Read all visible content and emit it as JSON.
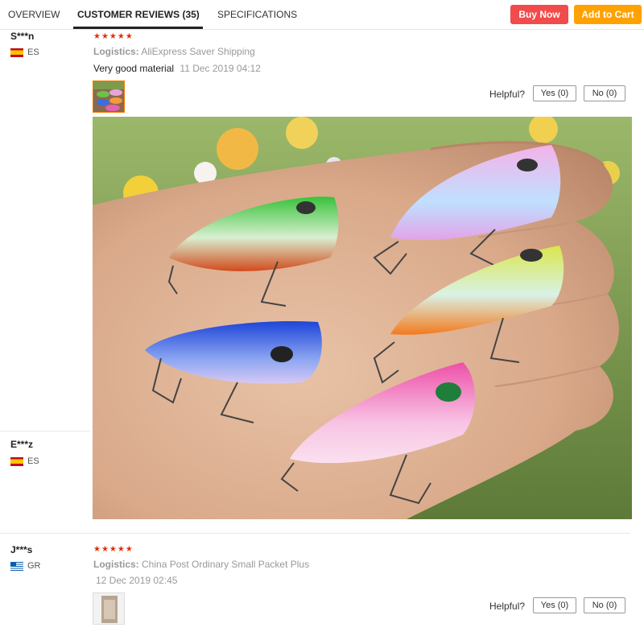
{
  "tabs": [
    {
      "label": "OVERVIEW"
    },
    {
      "label": "CUSTOMER REVIEWS (35)"
    },
    {
      "label": "SPECIFICATIONS"
    }
  ],
  "actions": {
    "buy_now": "Buy Now",
    "add_to_cart": "Add to Cart"
  },
  "reviews": [
    {
      "user": "S***n",
      "country": "ES",
      "stars": "★★★★★",
      "logistics_label": "Logistics:",
      "logistics_value": "AliExpress Saver Shipping",
      "feedback": "Very good material",
      "date": "11 Dec 2019 04:12",
      "helpful_label": "Helpful?",
      "yes_label": "Yes (0)",
      "no_label": "No (0)"
    },
    {
      "user": "E***z",
      "country": "ES"
    },
    {
      "user": "J***s",
      "country": "GR",
      "stars": "★★★★★",
      "logistics_label": "Logistics:",
      "logistics_value": "China Post Ordinary Small Packet Plus",
      "date": "12 Dec 2019 02:45",
      "helpful_label": "Helpful?",
      "yes_label": "Yes (0)",
      "no_label": "No (0)"
    }
  ]
}
